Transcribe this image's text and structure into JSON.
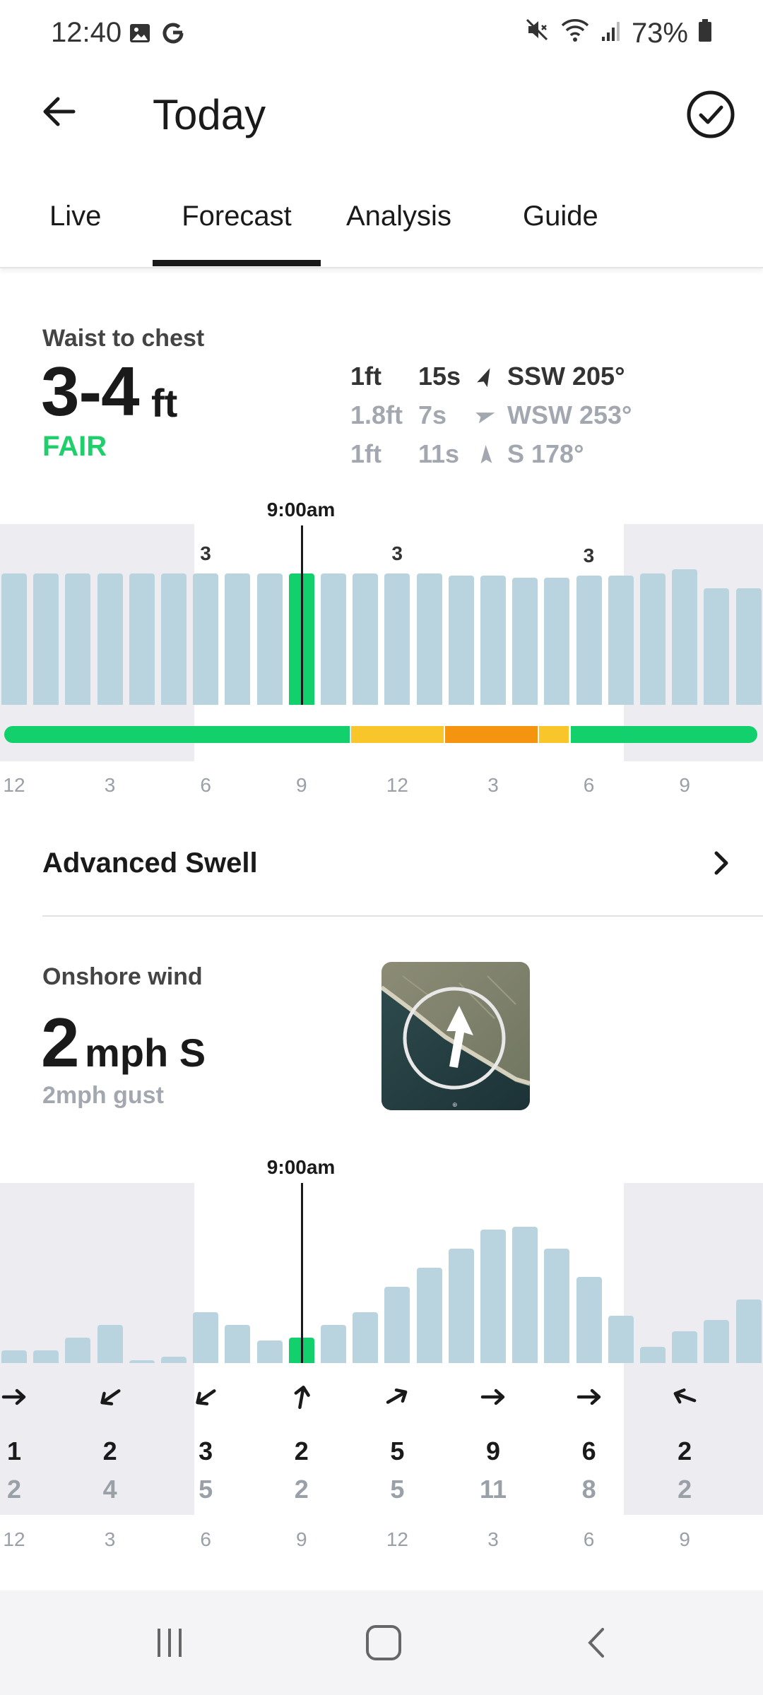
{
  "status_bar": {
    "time": "12:40",
    "battery": "73%"
  },
  "header": {
    "title": "Today"
  },
  "tabs": [
    {
      "label": "Live"
    },
    {
      "label": "Forecast"
    },
    {
      "label": "Analysis"
    },
    {
      "label": "Guide"
    }
  ],
  "surf": {
    "label": "Waist to chest",
    "height": "3-4",
    "unit": "ft",
    "rating": "FAIR",
    "rating_color": "#1ecf6c",
    "swells": [
      {
        "height": "1ft",
        "period": "15s",
        "direction": "SSW 205°",
        "degrees": 205
      },
      {
        "height": "1.8ft",
        "period": "7s",
        "direction": "WSW 253°",
        "degrees": 253
      },
      {
        "height": "1ft",
        "period": "11s",
        "direction": "S 178°",
        "degrees": 178
      }
    ]
  },
  "surf_chart": {
    "now_label": "9:00am",
    "current_index": 9,
    "bar_labels": [
      {
        "index": 6,
        "text": "3"
      },
      {
        "index": 12,
        "text": "3"
      },
      {
        "index": 18,
        "text": "3"
      }
    ],
    "bar_values": [
      3.1,
      3.1,
      3.1,
      3.1,
      3.1,
      3.1,
      3.1,
      3.1,
      3.1,
      3.1,
      3.1,
      3.1,
      3.1,
      3.1,
      3.05,
      3.05,
      3.0,
      3.0,
      3.05,
      3.05,
      3.1,
      3.2,
      2.75,
      2.75
    ],
    "rating_segments": [
      {
        "from": 0,
        "to": 11,
        "color": "#12d16d"
      },
      {
        "from": 11,
        "to": 14,
        "color": "#f8c62a"
      },
      {
        "from": 14,
        "to": 17,
        "color": "#f5940f"
      },
      {
        "from": 17,
        "to": 18,
        "color": "#f8c62a"
      },
      {
        "from": 18,
        "to": 24,
        "color": "#12d16d"
      }
    ],
    "time_labels": [
      "12",
      "3",
      "6",
      "9",
      "12",
      "3",
      "6",
      "9"
    ]
  },
  "advanced_swell": {
    "label": "Advanced Swell"
  },
  "wind": {
    "label": "Onshore wind",
    "speed": "2",
    "unit": "mph S",
    "gust": "2mph gust"
  },
  "wind_chart": {
    "now_label": "9:00am",
    "current_index": 9,
    "bar_values": [
      1,
      1,
      2,
      3,
      0.2,
      0.5,
      4,
      3,
      1.8,
      2,
      3,
      4,
      6,
      7.5,
      9,
      10.5,
      10.7,
      9,
      6.8,
      3.7,
      1.3,
      2.5,
      3.4,
      5
    ],
    "hours": [
      {
        "avg": "1",
        "gust": "2",
        "dir_deg": 90
      },
      {
        "avg": "2",
        "gust": "4",
        "dir_deg": 235
      },
      {
        "avg": "3",
        "gust": "5",
        "dir_deg": 235
      },
      {
        "avg": "2",
        "gust": "2",
        "dir_deg": 10
      },
      {
        "avg": "5",
        "gust": "5",
        "dir_deg": 60
      },
      {
        "avg": "9",
        "gust": "11",
        "dir_deg": 90
      },
      {
        "avg": "6",
        "gust": "8",
        "dir_deg": 90
      },
      {
        "avg": "2",
        "gust": "2",
        "dir_deg": 290
      }
    ],
    "time_labels": [
      "12",
      "3",
      "6",
      "9",
      "12",
      "3",
      "6",
      "9"
    ]
  }
}
